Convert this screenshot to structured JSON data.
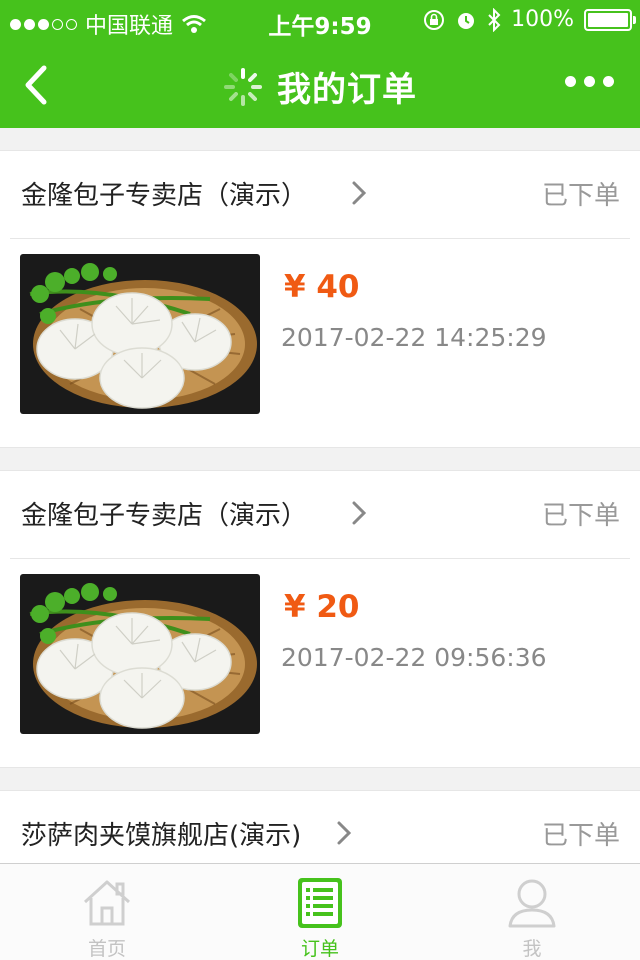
{
  "status_bar": {
    "carrier": "中国联通",
    "time": "上午9:59",
    "battery": "100%",
    "signal_strength": "3/5",
    "icons": [
      "wifi-icon",
      "rotation-lock-icon",
      "alarm-icon",
      "bluetooth-icon",
      "battery-icon"
    ]
  },
  "nav": {
    "title": "我的订单",
    "icons": [
      "back-icon",
      "loading-spinner-icon",
      "more-icon"
    ]
  },
  "colors": {
    "brand": "#46c21c",
    "price": "#f05a13",
    "muted": "#999999"
  },
  "orders": [
    {
      "shop": "金隆包子专卖店（演示）",
      "status": "已下单",
      "price": "¥ 40",
      "time": "2017-02-22 14:25:29",
      "image": "steamed-buns-photo"
    },
    {
      "shop": "金隆包子专卖店（演示）",
      "status": "已下单",
      "price": "¥ 20",
      "time": "2017-02-22 09:56:36",
      "image": "steamed-buns-photo"
    },
    {
      "shop": "莎萨肉夹馍旗舰店(演示)",
      "status": "已下单"
    }
  ],
  "tabbar": {
    "items": [
      {
        "label": "首页",
        "icon": "home-icon",
        "active": false
      },
      {
        "label": "订单",
        "icon": "order-list-icon",
        "active": true
      },
      {
        "label": "我",
        "icon": "user-icon",
        "active": false
      }
    ]
  }
}
